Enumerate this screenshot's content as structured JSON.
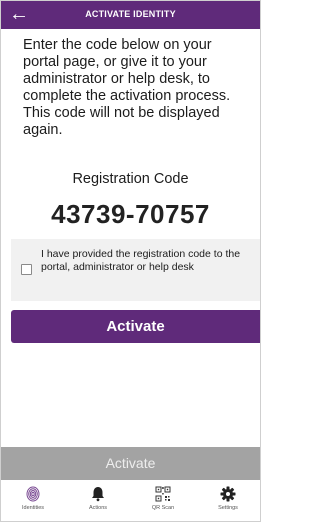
{
  "header": {
    "back_icon": "←",
    "title": "ACTIVATE IDENTITY"
  },
  "intro_text": "Enter the code below on your portal page, or give it to your administrator or help desk, to complete the activation process. This code will not be displayed again.",
  "registration": {
    "label": "Registration Code",
    "code": "43739-70757"
  },
  "confirmation": {
    "checked": false,
    "label": "I have provided the registration code to the portal, administrator or help desk"
  },
  "buttons": {
    "activate_primary": "Activate",
    "activate_footer": "Activate"
  },
  "tabs": [
    {
      "label": "Identities",
      "icon": "fingerprint-icon"
    },
    {
      "label": "Actions",
      "icon": "bell-icon"
    },
    {
      "label": "QR Scan",
      "icon": "qr-code-icon"
    },
    {
      "label": "Settings",
      "icon": "gear-icon"
    }
  ],
  "colors": {
    "brand_purple": "#5f2a7a",
    "disabled_gray": "#a3a3a3"
  }
}
